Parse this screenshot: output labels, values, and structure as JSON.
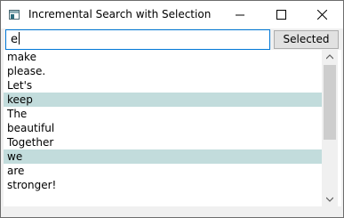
{
  "window": {
    "title": "Incremental Search with Selection"
  },
  "search": {
    "value": "e"
  },
  "toolbar": {
    "selected_label": "Selected"
  },
  "list": {
    "items": [
      {
        "text": "make",
        "selected": false
      },
      {
        "text": "please.",
        "selected": false
      },
      {
        "text": "Let's",
        "selected": false
      },
      {
        "text": "keep",
        "selected": true
      },
      {
        "text": "The",
        "selected": false
      },
      {
        "text": "beautiful",
        "selected": false
      },
      {
        "text": "Together",
        "selected": false
      },
      {
        "text": "we",
        "selected": true
      },
      {
        "text": "are",
        "selected": false
      },
      {
        "text": "stronger!",
        "selected": false
      }
    ]
  },
  "colors": {
    "selection": "#c2dcdc",
    "focus_border": "#0078d7"
  }
}
